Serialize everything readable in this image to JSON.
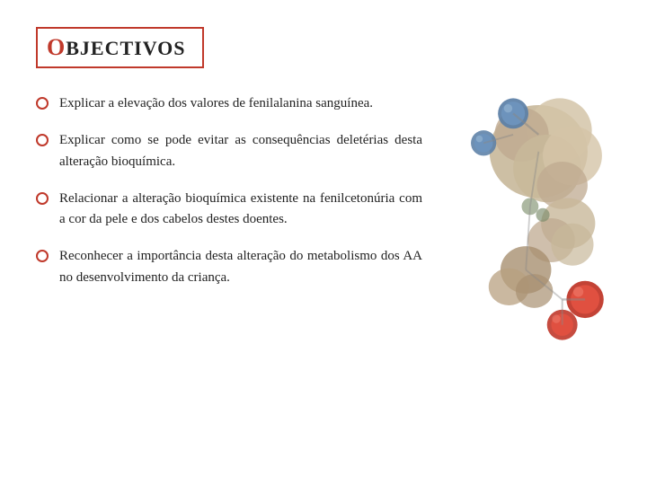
{
  "title": {
    "first_letter": "O",
    "rest": "BJECTIVOS"
  },
  "bullets": [
    {
      "id": "bullet-1",
      "text": "Explicar  a  elevação  dos  valores  de  fenilalanina sanguínea."
    },
    {
      "id": "bullet-2",
      "text": "Explicar  como  se  pode  evitar  as  consequências deletérias desta alteração bioquímica."
    },
    {
      "id": "bullet-3",
      "text": "Relacionar  a  alteração  bioquímica  existente  na fenilcetonúria com a cor da pele e dos cabelos destes doentes."
    },
    {
      "id": "bullet-4",
      "text": "Reconhecer  a  importância  desta  alteração  do metabolismo dos AA no desenvolvimento da criança."
    }
  ],
  "accent_color": "#c0392b"
}
